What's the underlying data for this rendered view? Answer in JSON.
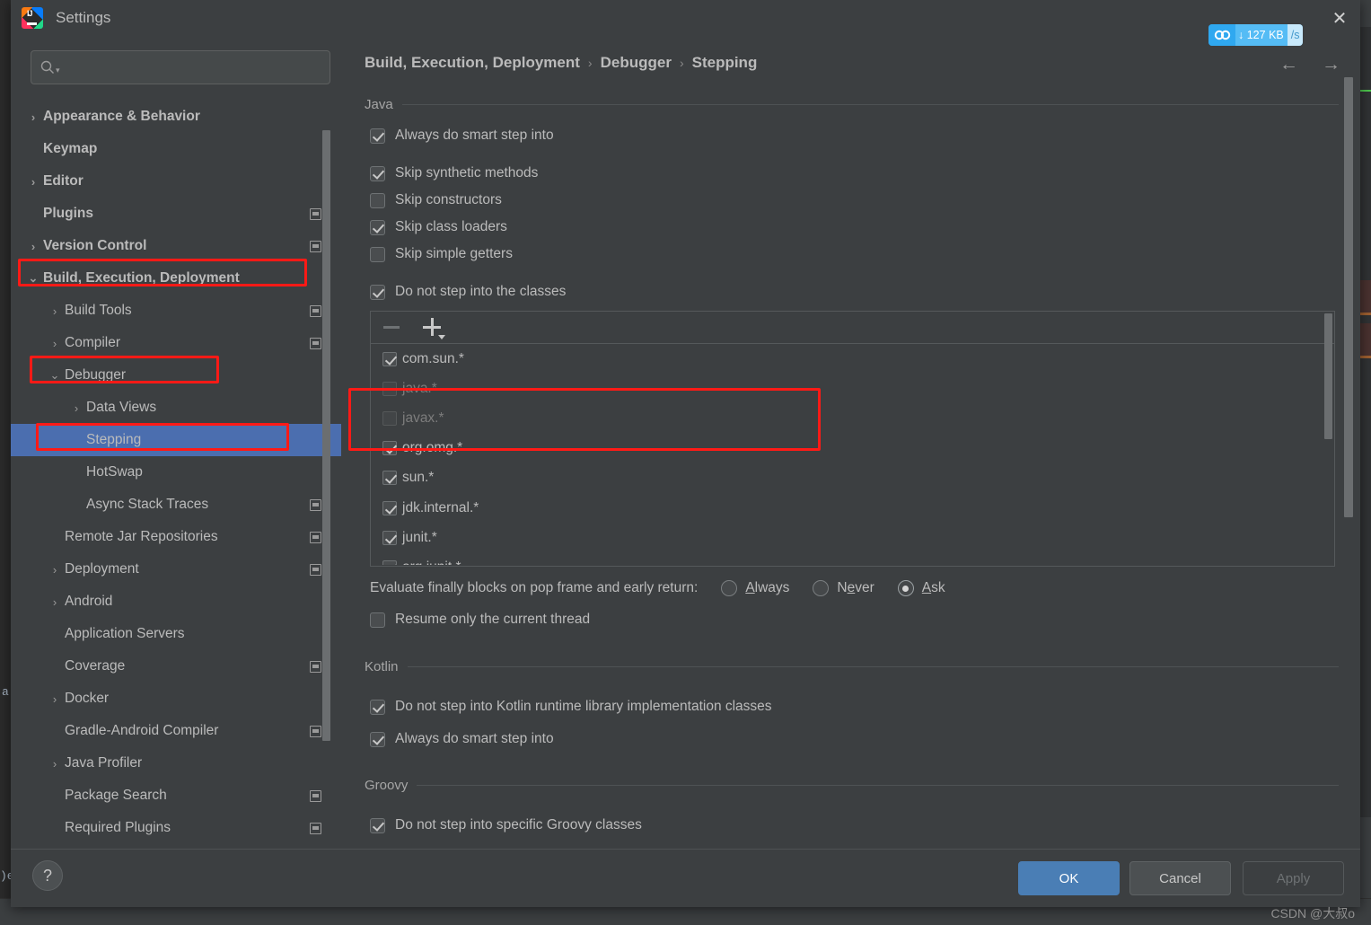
{
  "window": {
    "title": "Settings",
    "logo_text": "IJ",
    "close_icon": "✕"
  },
  "net_badge": {
    "icon": "cloud-icon",
    "arrow": "↓",
    "value": "127 KB",
    "unit": "/s"
  },
  "search": {
    "placeholder": "",
    "value": "",
    "icon": "search-icon"
  },
  "sidebar": {
    "items": [
      {
        "label": "Appearance & Behavior",
        "arrow": "›",
        "indent": 0,
        "bold": true,
        "badge": false,
        "selected": false
      },
      {
        "label": "Keymap",
        "arrow": "",
        "indent": 0,
        "bold": true,
        "badge": false,
        "selected": false
      },
      {
        "label": "Editor",
        "arrow": "›",
        "indent": 0,
        "bold": true,
        "badge": false,
        "selected": false
      },
      {
        "label": "Plugins",
        "arrow": "",
        "indent": 0,
        "bold": true,
        "badge": true,
        "selected": false
      },
      {
        "label": "Version Control",
        "arrow": "›",
        "indent": 0,
        "bold": true,
        "badge": true,
        "selected": false
      },
      {
        "label": "Build, Execution, Deployment",
        "arrow": "⌄",
        "indent": 0,
        "bold": true,
        "badge": false,
        "selected": false
      },
      {
        "label": "Build Tools",
        "arrow": "›",
        "indent": 1,
        "bold": false,
        "badge": true,
        "selected": false
      },
      {
        "label": "Compiler",
        "arrow": "›",
        "indent": 1,
        "bold": false,
        "badge": true,
        "selected": false
      },
      {
        "label": "Debugger",
        "arrow": "⌄",
        "indent": 1,
        "bold": false,
        "badge": false,
        "selected": false
      },
      {
        "label": "Data Views",
        "arrow": "›",
        "indent": 2,
        "bold": false,
        "badge": false,
        "selected": false
      },
      {
        "label": "Stepping",
        "arrow": "",
        "indent": 2,
        "bold": false,
        "badge": false,
        "selected": true
      },
      {
        "label": "HotSwap",
        "arrow": "",
        "indent": 2,
        "bold": false,
        "badge": false,
        "selected": false
      },
      {
        "label": "Async Stack Traces",
        "arrow": "",
        "indent": 2,
        "bold": false,
        "badge": true,
        "selected": false
      },
      {
        "label": "Remote Jar Repositories",
        "arrow": "",
        "indent": 1,
        "bold": false,
        "badge": true,
        "selected": false
      },
      {
        "label": "Deployment",
        "arrow": "›",
        "indent": 1,
        "bold": false,
        "badge": true,
        "selected": false
      },
      {
        "label": "Android",
        "arrow": "›",
        "indent": 1,
        "bold": false,
        "badge": false,
        "selected": false
      },
      {
        "label": "Application Servers",
        "arrow": "",
        "indent": 1,
        "bold": false,
        "badge": false,
        "selected": false
      },
      {
        "label": "Coverage",
        "arrow": "",
        "indent": 1,
        "bold": false,
        "badge": true,
        "selected": false
      },
      {
        "label": "Docker",
        "arrow": "›",
        "indent": 1,
        "bold": false,
        "badge": false,
        "selected": false
      },
      {
        "label": "Gradle-Android Compiler",
        "arrow": "",
        "indent": 1,
        "bold": false,
        "badge": true,
        "selected": false
      },
      {
        "label": "Java Profiler",
        "arrow": "›",
        "indent": 1,
        "bold": false,
        "badge": false,
        "selected": false
      },
      {
        "label": "Package Search",
        "arrow": "",
        "indent": 1,
        "bold": false,
        "badge": true,
        "selected": false
      },
      {
        "label": "Required Plugins",
        "arrow": "",
        "indent": 1,
        "bold": false,
        "badge": true,
        "selected": false
      }
    ]
  },
  "breadcrumb": {
    "parts": [
      "Build, Execution, Deployment",
      "Debugger",
      "Stepping"
    ],
    "separator": "›",
    "back_icon": "←",
    "forward_icon": "→"
  },
  "java_section": {
    "title": "Java",
    "checkboxes": [
      {
        "label": "Always do smart step into",
        "checked": true
      },
      {
        "label": "Skip synthetic methods",
        "checked": true
      },
      {
        "label": "Skip constructors",
        "checked": false
      },
      {
        "label": "Skip class loaders",
        "checked": true
      },
      {
        "label": "Skip simple getters",
        "checked": false
      },
      {
        "label": "Do not step into the classes",
        "checked": true
      }
    ],
    "toolbar": {
      "remove_icon": "minus-icon",
      "add_icon": "plus-icon"
    },
    "class_list": [
      {
        "label": "com.sun.*",
        "checked": true,
        "dim": false
      },
      {
        "label": "java.*",
        "checked": false,
        "dim": true
      },
      {
        "label": "javax.*",
        "checked": false,
        "dim": true
      },
      {
        "label": "org.omg.*",
        "checked": true,
        "dim": false
      },
      {
        "label": "sun.*",
        "checked": true,
        "dim": false
      },
      {
        "label": "jdk.internal.*",
        "checked": true,
        "dim": false
      },
      {
        "label": "junit.*",
        "checked": true,
        "dim": false
      },
      {
        "label": "org.junit.*",
        "checked": true,
        "dim": false
      }
    ],
    "finally_label": "Evaluate finally blocks on pop frame and early return:",
    "finally_options": [
      {
        "label": "Always",
        "selected": false
      },
      {
        "label": "Never",
        "selected": false
      },
      {
        "label": "Ask",
        "selected": true
      }
    ],
    "resume_checkbox": {
      "label": "Resume only the current thread",
      "checked": false
    }
  },
  "kotlin_section": {
    "title": "Kotlin",
    "checkboxes": [
      {
        "label": "Do not step into Kotlin runtime library implementation classes",
        "checked": true
      },
      {
        "label": "Always do smart step into",
        "checked": true
      }
    ]
  },
  "groovy_section": {
    "title": "Groovy",
    "checkboxes": [
      {
        "label": "Do not step into specific Groovy classes",
        "checked": true
      }
    ]
  },
  "footer": {
    "help_label": "?",
    "ok_label": "OK",
    "cancel_label": "Cancel",
    "apply_label": "Apply"
  },
  "watermark": "CSDN @大叔o",
  "colors": {
    "background": "#3C3F41",
    "selection": "#4B6EAF",
    "accent_button": "#4A7EB5",
    "annotation": "#FF1A16",
    "net_badge": "#2FA8F0",
    "text": "#BBBBBB"
  }
}
